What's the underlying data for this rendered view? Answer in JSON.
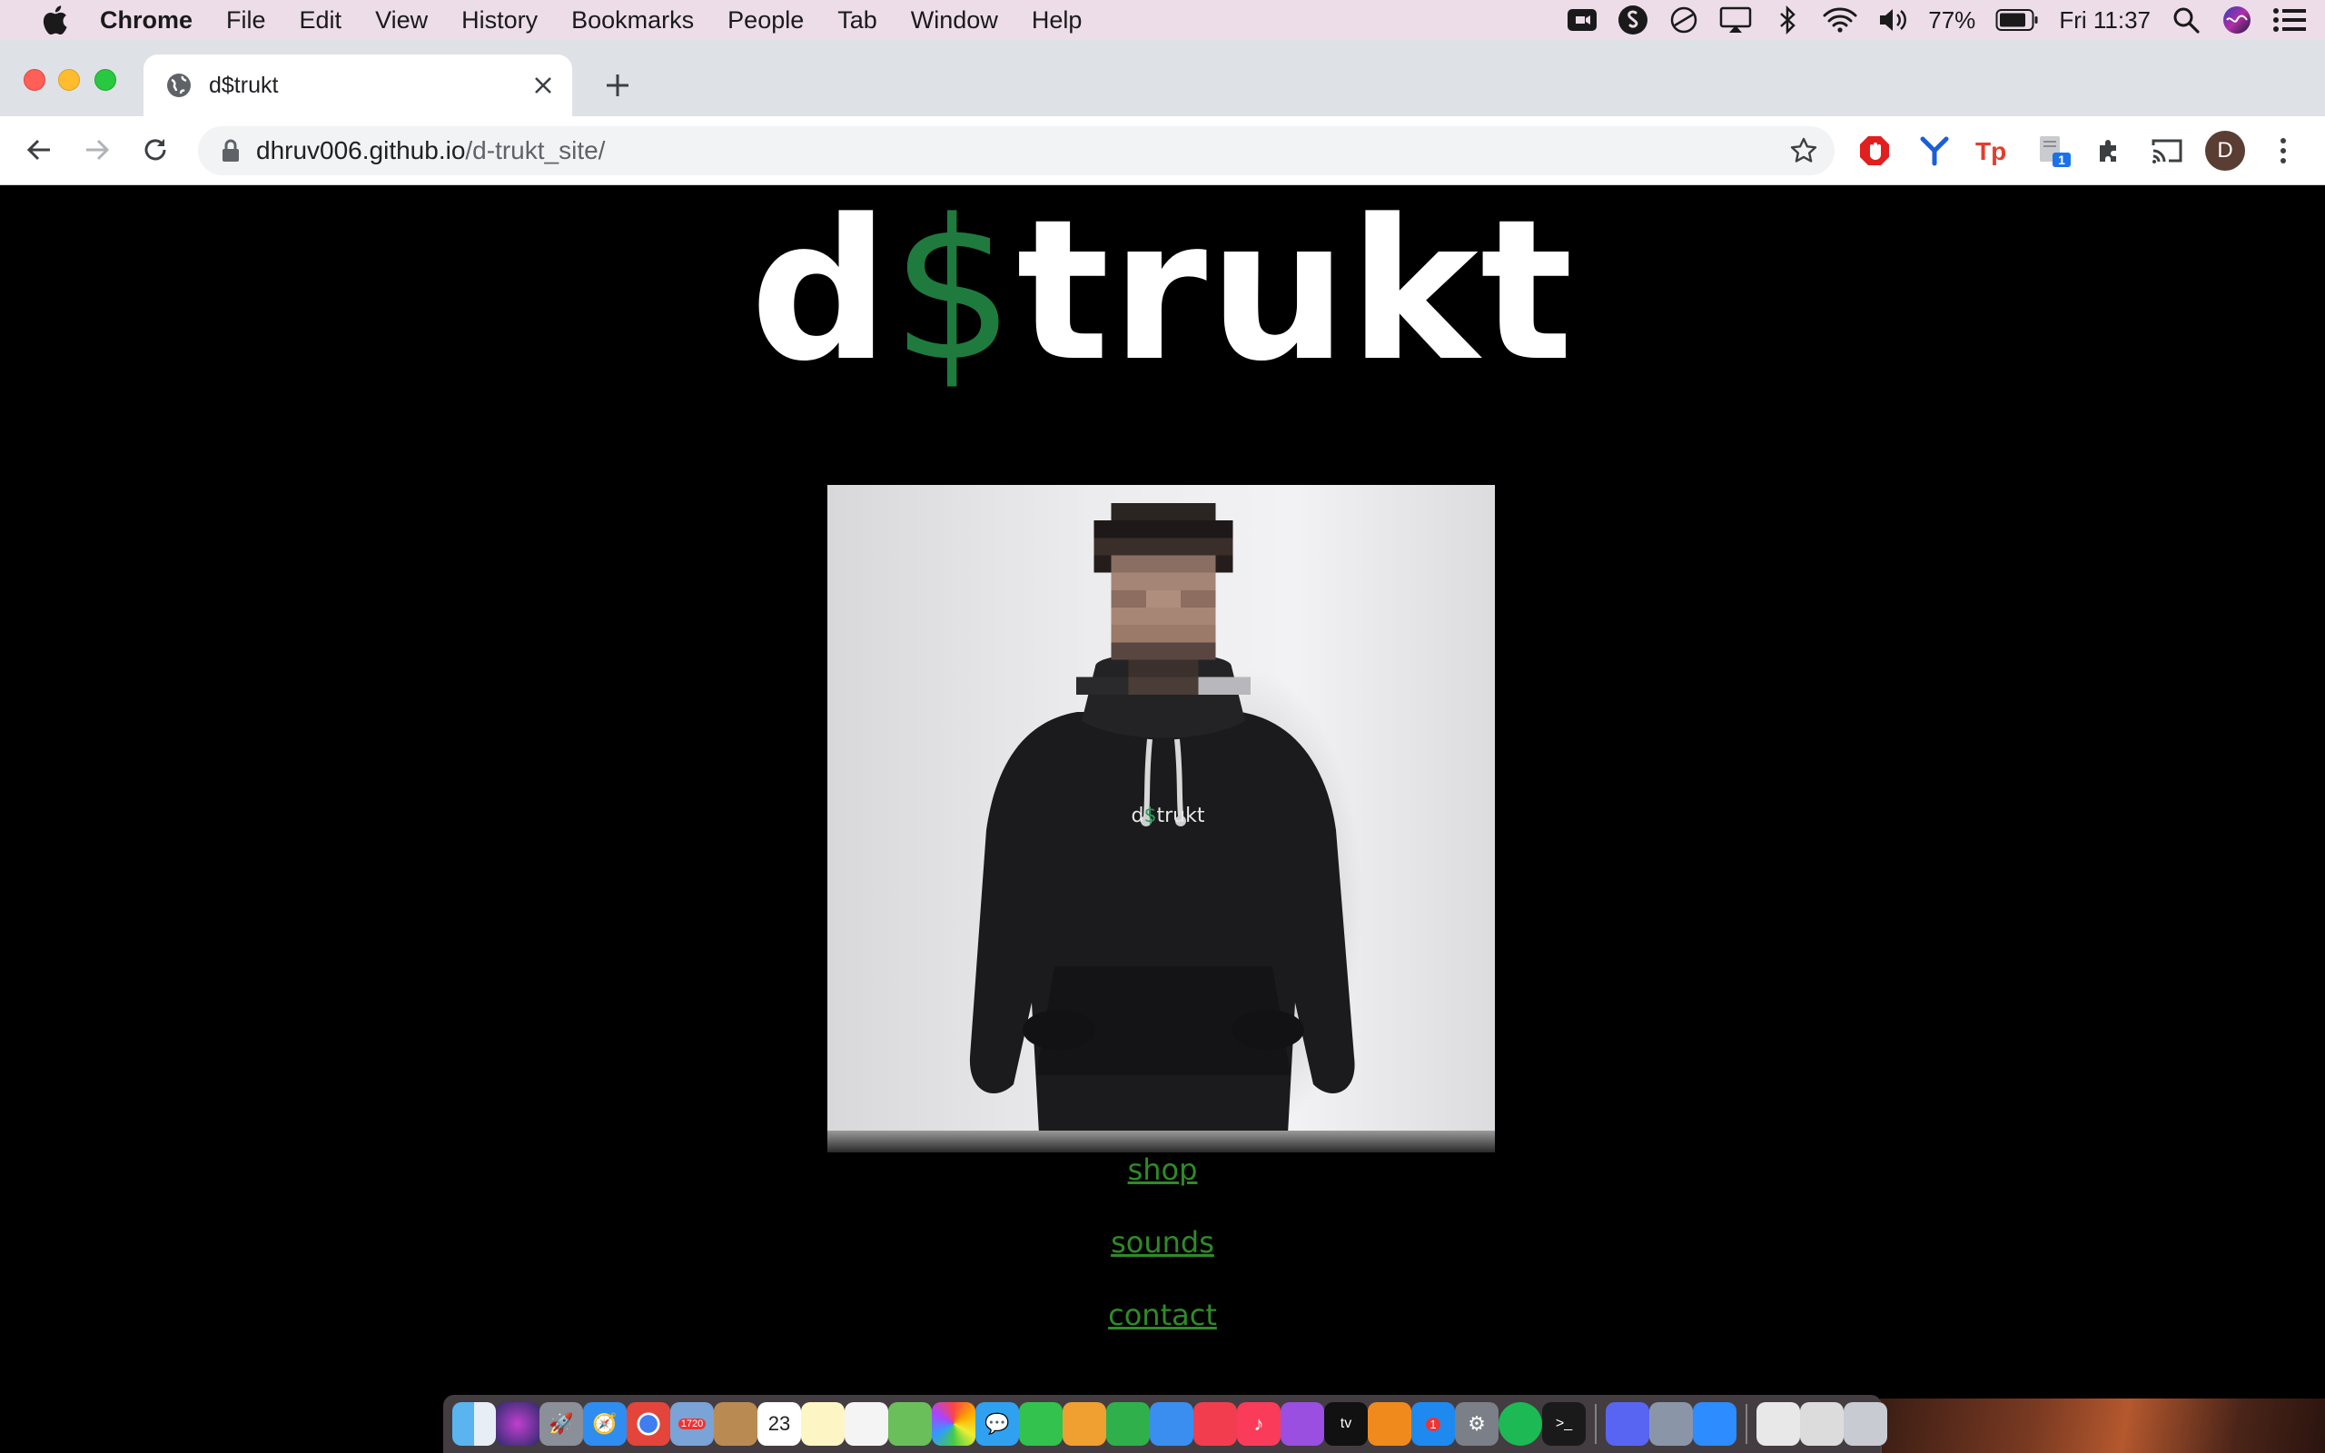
{
  "menubar": {
    "app_name": "Chrome",
    "items": [
      "File",
      "Edit",
      "View",
      "History",
      "Bookmarks",
      "People",
      "Tab",
      "Window",
      "Help"
    ],
    "battery_percent": "77%",
    "clock": "Fri 11:37"
  },
  "browser": {
    "tab_title": "d$trukt",
    "url_host": "dhruv006.github.io",
    "url_path": "/d-trukt_site/",
    "profile_initial": "D",
    "extension_badge": "1"
  },
  "page": {
    "logo_prefix": "d",
    "logo_symbol": "$",
    "logo_suffix": "trukt",
    "hoodie_print_prefix": "d",
    "hoodie_print_symbol": "$",
    "hoodie_print_suffix": "trukt",
    "links": {
      "shop": "shop",
      "sounds": "sounds",
      "contact": "contact"
    },
    "colors": {
      "background": "#000000",
      "logo_text": "#ffffff",
      "logo_dollar": "#1f7a3e",
      "link": "#2e8b27"
    }
  },
  "dock": {
    "calendar_day": "23",
    "mail_badge": "1720",
    "appstore_badge": "1",
    "tv_label": "tv"
  }
}
